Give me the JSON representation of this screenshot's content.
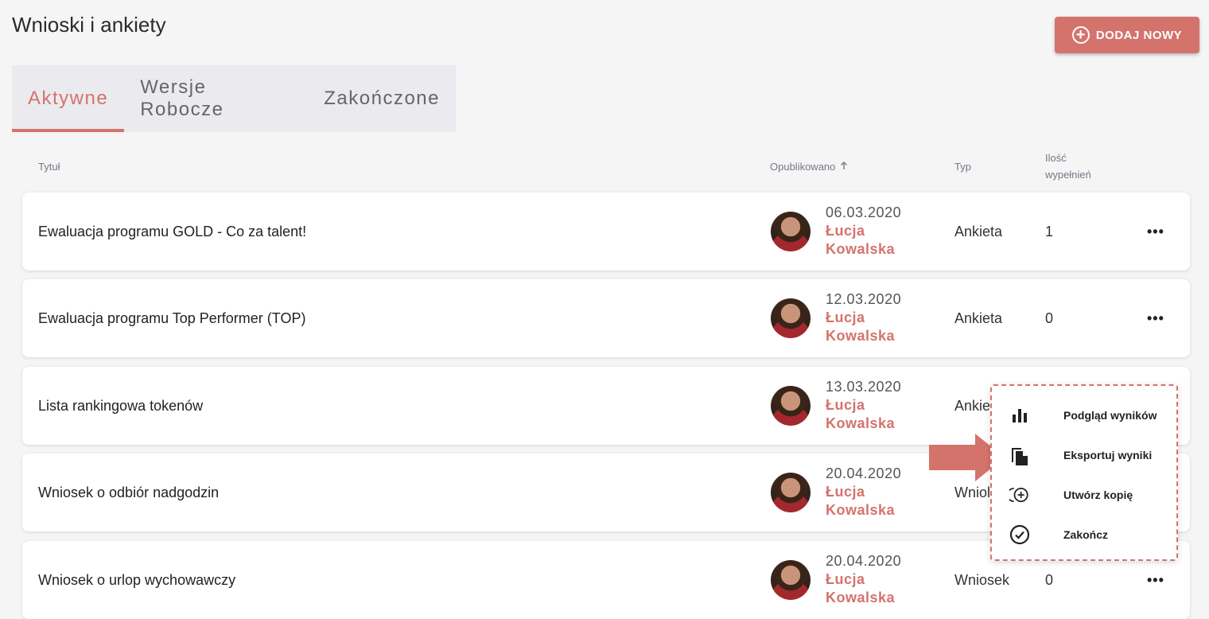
{
  "header": {
    "title": "Wnioski i ankiety",
    "add_button_label": "DODAJ NOWY"
  },
  "tabs": [
    {
      "label": "Aktywne",
      "active": true
    },
    {
      "label": "Wersje Robocze",
      "active": false
    },
    {
      "label": "Zakończone",
      "active": false
    }
  ],
  "columns": {
    "title": "Tytuł",
    "published": "Opublikowano",
    "type": "Typ",
    "count_line1": "Ilość",
    "count_line2": "wypełnień"
  },
  "rows": [
    {
      "title": "Ewaluacja programu GOLD - Co za talent!",
      "date": "06.03.2020",
      "author_first": "Łucja",
      "author_last": "Kowalska",
      "type": "Ankieta",
      "count": "1"
    },
    {
      "title": "Ewaluacja programu Top Performer (TOP)",
      "date": "12.03.2020",
      "author_first": "Łucja",
      "author_last": "Kowalska",
      "type": "Ankieta",
      "count": "0"
    },
    {
      "title": "Lista rankingowa tokenów",
      "date": "13.03.2020",
      "author_first": "Łucja",
      "author_last": "Kowalska",
      "type": "Ankie",
      "count": ""
    },
    {
      "title": "Wniosek o odbiór nadgodzin",
      "date": "20.04.2020",
      "author_first": "Łucja",
      "author_last": "Kowalska",
      "type": "Wniol",
      "count": ""
    },
    {
      "title": "Wniosek o urlop wychowawczy",
      "date": "20.04.2020",
      "author_first": "Łucja",
      "author_last": "Kowalska",
      "type": "Wniosek",
      "count": "0"
    }
  ],
  "more_label": "•••",
  "context_menu": [
    {
      "label": "Podgląd wyników",
      "icon": "bar-chart-icon"
    },
    {
      "label": "Eksportuj wyniki",
      "icon": "file-copy-icon"
    },
    {
      "label": "Utwórz kopię",
      "icon": "add-copy-icon"
    },
    {
      "label": "Zakończ",
      "icon": "check-circle-icon"
    }
  ],
  "colors": {
    "accent": "#d4736c",
    "background": "#f5f5f5",
    "tabs_background": "#ebebef"
  }
}
